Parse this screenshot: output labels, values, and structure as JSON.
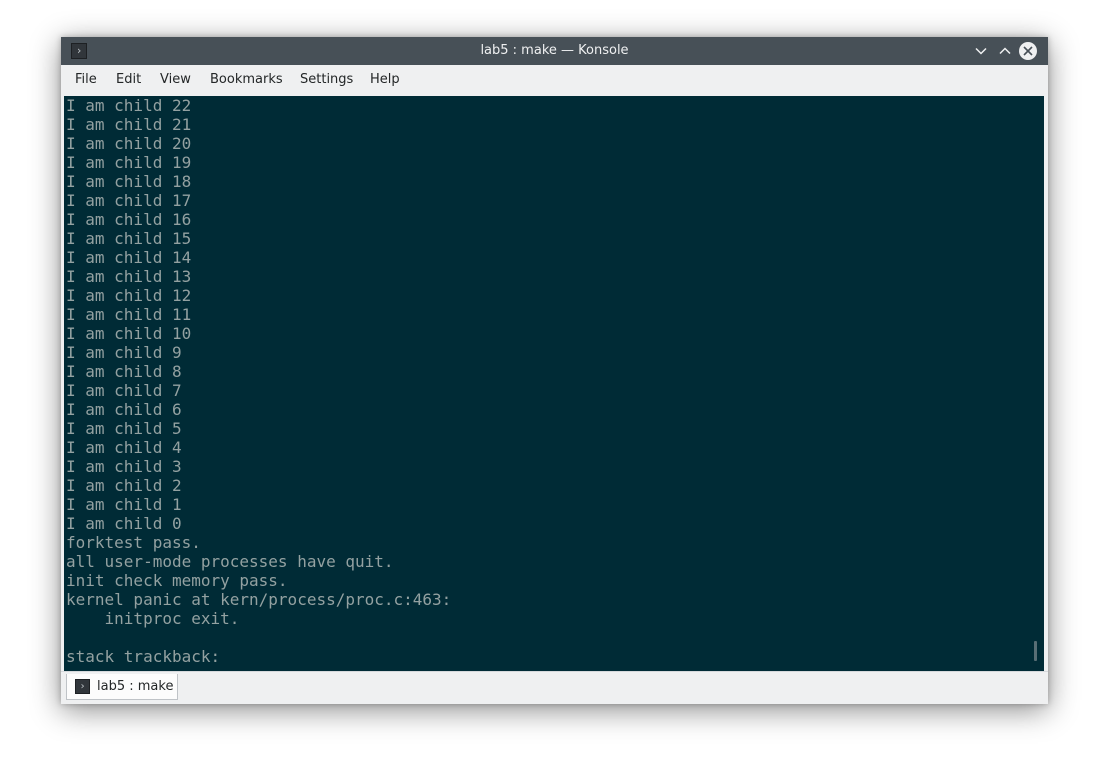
{
  "window": {
    "title": "lab5 : make — Konsole",
    "app_icon_glyph": "›",
    "controls": {
      "minimize_icon": "chevron-down-icon",
      "maximize_icon": "chevron-up-icon",
      "close_icon": "close-icon"
    }
  },
  "menu": {
    "items": [
      {
        "label": "File"
      },
      {
        "label": "Edit"
      },
      {
        "label": "View"
      },
      {
        "label": "Bookmarks"
      },
      {
        "label": "Settings"
      },
      {
        "label": "Help"
      }
    ]
  },
  "terminal": {
    "colors": {
      "background": "#002b36",
      "foreground": "#93a1a1"
    },
    "lines": [
      "I am child 22",
      "I am child 21",
      "I am child 20",
      "I am child 19",
      "I am child 18",
      "I am child 17",
      "I am child 16",
      "I am child 15",
      "I am child 14",
      "I am child 13",
      "I am child 12",
      "I am child 11",
      "I am child 10",
      "I am child 9",
      "I am child 8",
      "I am child 7",
      "I am child 6",
      "I am child 5",
      "I am child 4",
      "I am child 3",
      "I am child 2",
      "I am child 1",
      "I am child 0",
      "forktest pass.",
      "all user-mode processes have quit.",
      "init check memory pass.",
      "kernel panic at kern/process/proc.c:463:",
      "    initproc exit.",
      "",
      "stack trackback:"
    ]
  },
  "tabs": [
    {
      "label": "lab5 : make",
      "icon": "terminal-icon",
      "icon_glyph": "›"
    }
  ]
}
